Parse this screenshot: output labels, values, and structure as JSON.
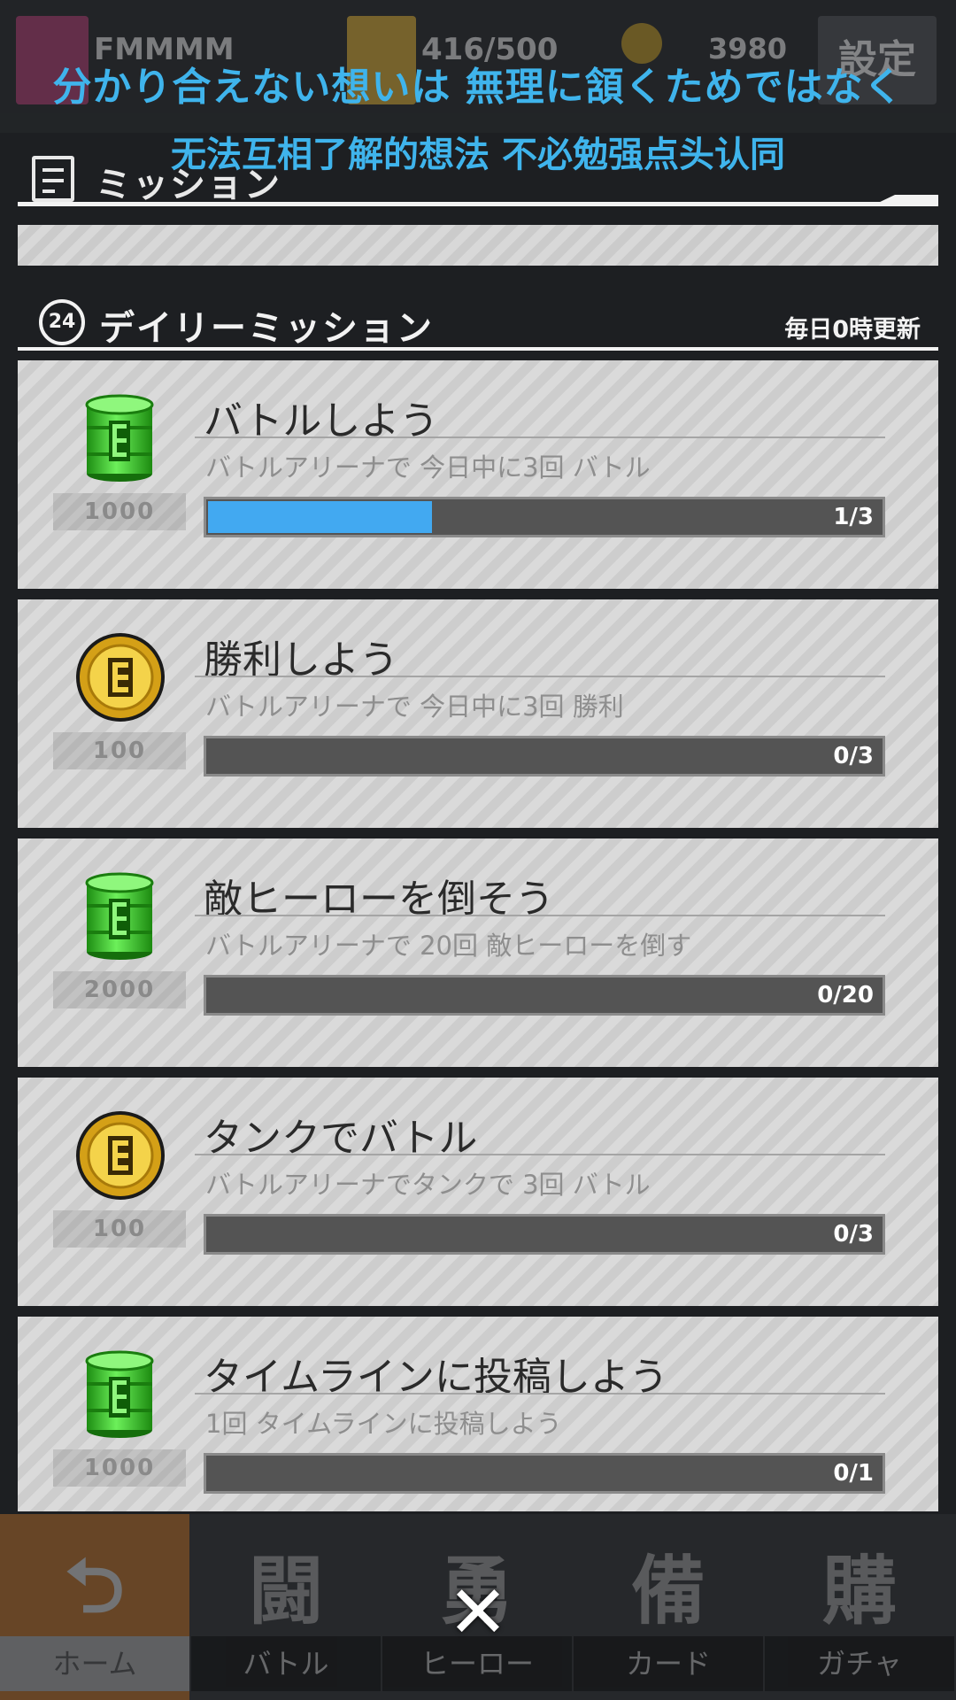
{
  "topbar": {
    "player_name": "FMMMM",
    "stamina": "416/500",
    "coins": "3980",
    "settings_label": "設定"
  },
  "subtitles": {
    "japanese": "分かり合えない想いは 無理に頷くためではなく",
    "chinese": "无法互相了解的想法 不必勉强点头认同"
  },
  "header": {
    "title": "ミッション"
  },
  "daily": {
    "icon_label": "24",
    "title": "デイリーミッション",
    "refresh_note": "毎日0時更新"
  },
  "missions": [
    {
      "title": "バトルしよう",
      "description": "バトルアリーナで 今日中に3回 バトル",
      "reward": "1000",
      "reward_icon": "green-barrel-icon",
      "progress_label": "1/3",
      "progress_fraction": 0.333
    },
    {
      "title": "勝利しよう",
      "description": "バトルアリーナで 今日中に3回 勝利",
      "reward": "100",
      "reward_icon": "gold-coin-icon",
      "progress_label": "0/3",
      "progress_fraction": 0
    },
    {
      "title": "敵ヒーローを倒そう",
      "description": "バトルアリーナで 20回 敵ヒーローを倒す",
      "reward": "2000",
      "reward_icon": "green-barrel-icon",
      "progress_label": "0/20",
      "progress_fraction": 0
    },
    {
      "title": "タンクでバトル",
      "description": "バトルアリーナでタンクで 3回 バトル",
      "reward": "100",
      "reward_icon": "gold-coin-icon",
      "progress_label": "0/3",
      "progress_fraction": 0
    },
    {
      "title": "タイムラインに投稿しよう",
      "description": "1回 タイムラインに投稿しよう",
      "reward": "1000",
      "reward_icon": "green-barrel-icon",
      "progress_label": "0/1",
      "progress_fraction": 0
    }
  ],
  "nav": [
    {
      "glyph": "⮌",
      "label": "ホーム"
    },
    {
      "glyph": "闘",
      "label": "バトル"
    },
    {
      "glyph": "勇",
      "label": "ヒーロー"
    },
    {
      "glyph": "備",
      "label": "カード"
    },
    {
      "glyph": "購",
      "label": "ガチャ"
    }
  ],
  "close_glyph": "✕",
  "colors": {
    "progress_fill": "#42a9f1",
    "subtitle": "#3fb4ec",
    "home_tab": "#e07b1d"
  }
}
